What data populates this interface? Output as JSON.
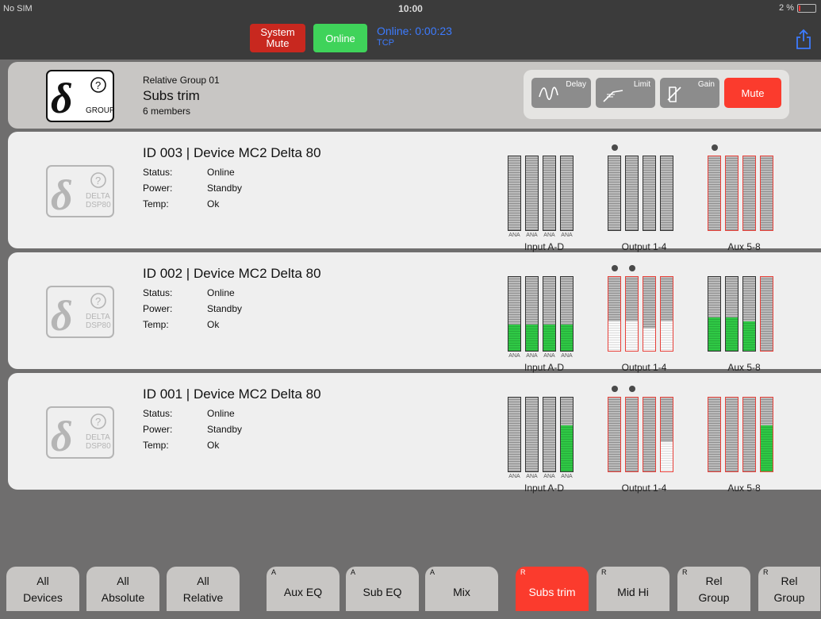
{
  "status_bar": {
    "carrier": "No SIM",
    "time": "10:00",
    "battery": "2 %"
  },
  "top_bar": {
    "system_mute_label": "System\nMute",
    "online_label": "Online",
    "online_timer": "Online: 0:00:23",
    "transport": "TCP"
  },
  "group": {
    "logo_text": "GROUP",
    "subtitle": "Relative Group 01",
    "title": "Subs trim",
    "members": "6 members",
    "fx": {
      "delay": "Delay",
      "limit": "Limit",
      "gain": "Gain",
      "mute": "Mute"
    }
  },
  "field_labels": {
    "status": "Status:",
    "power": "Power:",
    "temp": "Temp:"
  },
  "meter_labels": {
    "input": "Input A-D",
    "output": "Output 1-4",
    "aux": "Aux 5-8",
    "ana": "ANA"
  },
  "devices": [
    {
      "title": "ID 003 | Device MC2 Delta 80",
      "status": "Online",
      "power": "Standby",
      "temp": "Ok",
      "logo_line1": "DELTA",
      "logo_line2": "DSP80",
      "input_levels": [
        0,
        0,
        0,
        0
      ],
      "input_fill": [
        "none",
        "none",
        "none",
        "none"
      ],
      "input_red": [
        false,
        false,
        false,
        false
      ],
      "output_levels": [
        0,
        0,
        0,
        0
      ],
      "output_fill": [
        "none",
        "none",
        "none",
        "none"
      ],
      "output_red": [
        false,
        false,
        false,
        false
      ],
      "output_dots": [
        0
      ],
      "aux_levels": [
        0,
        0,
        0,
        0
      ],
      "aux_fill": [
        "none",
        "none",
        "none",
        "none"
      ],
      "aux_red": [
        true,
        true,
        true,
        true
      ],
      "aux_dots": [
        0
      ]
    },
    {
      "title": "ID 002 | Device MC2 Delta 80",
      "status": "Online",
      "power": "Standby",
      "temp": "Ok",
      "logo_line1": "DELTA",
      "logo_line2": "DSP80",
      "input_levels": [
        0.35,
        0.35,
        0.35,
        0.35
      ],
      "input_fill": [
        "green",
        "green",
        "green",
        "green"
      ],
      "input_red": [
        false,
        false,
        false,
        false
      ],
      "output_levels": [
        0.4,
        0.4,
        0.3,
        0.4
      ],
      "output_fill": [
        "white",
        "white",
        "white",
        "white"
      ],
      "output_red": [
        true,
        true,
        true,
        true
      ],
      "output_dots": [
        0,
        1
      ],
      "aux_levels": [
        0.45,
        0.45,
        0.4,
        0
      ],
      "aux_fill": [
        "green",
        "green",
        "green",
        "none"
      ],
      "aux_red": [
        false,
        false,
        false,
        true
      ],
      "aux_dots": []
    },
    {
      "title": "ID 001 | Device MC2 Delta 80",
      "status": "Online",
      "power": "Standby",
      "temp": "Ok",
      "logo_line1": "DELTA",
      "logo_line2": "DSP80",
      "input_levels": [
        0,
        0,
        0,
        0.62
      ],
      "input_fill": [
        "none",
        "none",
        "none",
        "green"
      ],
      "input_red": [
        false,
        false,
        false,
        false
      ],
      "output_levels": [
        0,
        0,
        0,
        0.4
      ],
      "output_fill": [
        "none",
        "none",
        "none",
        "white"
      ],
      "output_red": [
        true,
        true,
        true,
        true
      ],
      "output_dots": [
        0,
        1
      ],
      "aux_levels": [
        0,
        0,
        0,
        0.62
      ],
      "aux_fill": [
        "none",
        "none",
        "none",
        "green"
      ],
      "aux_red": [
        true,
        true,
        true,
        true
      ],
      "aux_dots": []
    }
  ],
  "tabs": [
    {
      "prefix": "",
      "label": "All\nDevices",
      "active": false
    },
    {
      "prefix": "",
      "label": "All\nAbsolute",
      "active": false
    },
    {
      "prefix": "",
      "label": "All\nRelative",
      "active": false
    },
    {
      "prefix": "A",
      "label": "Aux EQ",
      "active": false
    },
    {
      "prefix": "A",
      "label": "Sub EQ",
      "active": false
    },
    {
      "prefix": "A",
      "label": "Mix",
      "active": false
    },
    {
      "prefix": "R",
      "label": "Subs trim",
      "active": true
    },
    {
      "prefix": "R",
      "label": "Mid Hi",
      "active": false
    },
    {
      "prefix": "R",
      "label": "Rel\nGroup",
      "active": false
    },
    {
      "prefix": "R",
      "label": "Rel\nGroup",
      "active": false
    }
  ],
  "colors": {
    "mute_red": "#fb3b2d",
    "online_green": "#3fd35a",
    "timer_blue": "#3c7bff",
    "meter_green": "#2fc845",
    "clip_red": "#e8413a"
  }
}
